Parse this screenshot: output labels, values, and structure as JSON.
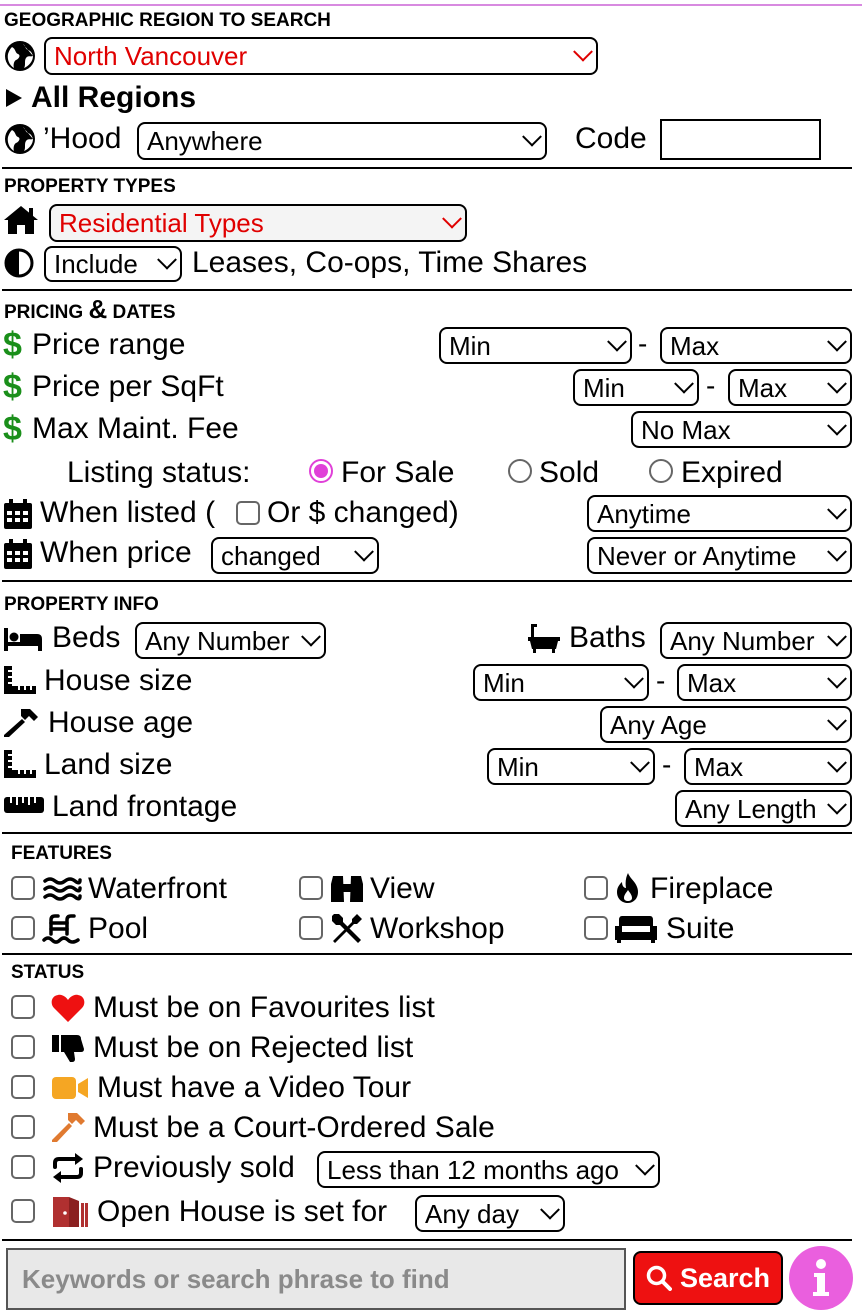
{
  "region": {
    "title": "GEOGRAPHIC REGION TO SEARCH",
    "region_select": "North Vancouver",
    "all_regions": "All Regions",
    "hood_label": "’Hood",
    "hood_select": "Anywhere",
    "code_label": "Code",
    "code_value": ""
  },
  "property_types": {
    "title": "PROPERTY TYPES",
    "types_select": "Residential Types",
    "include_select": "Include",
    "include_label": "Leases, Co-ops, Time Shares"
  },
  "pricing": {
    "title_a": "PRICING",
    "title_amp": "&",
    "title_b": "DATES",
    "price_range_label": "Price range",
    "price_min": "Min",
    "price_max": "Max",
    "sqft_label": "Price per SqFt",
    "sqft_min": "Min",
    "sqft_max": "Max",
    "maint_label": "Max Maint. Fee",
    "maint_select": "No Max",
    "status_label": "Listing status:",
    "status_options": [
      "For Sale",
      "Sold",
      "Expired"
    ],
    "status_selected": "For Sale",
    "listed_label_a": "When listed (",
    "listed_label_b": "Or $ changed)",
    "listed_select": "Anytime",
    "price_label": "When price",
    "price_changed_select": "changed",
    "price_when_select": "Never or Anytime",
    "dash": "-"
  },
  "property_info": {
    "title": "PROPERTY INFO",
    "beds_label": "Beds",
    "beds_select": "Any Number",
    "baths_label": "Baths",
    "baths_select": "Any Number",
    "house_size_label": "House size",
    "house_min": "Min",
    "house_max": "Max",
    "house_age_label": "House age",
    "house_age_select": "Any Age",
    "land_size_label": "Land size",
    "land_min": "Min",
    "land_max": "Max",
    "frontage_label": "Land frontage",
    "frontage_select": "Any Length"
  },
  "features": {
    "title": "FEATURES",
    "items": [
      "Waterfront",
      "View",
      "Fireplace",
      "Pool",
      "Workshop",
      "Suite"
    ]
  },
  "status": {
    "title": "STATUS",
    "favourites": "Must be on Favourites list",
    "rejected": "Must be on Rejected list",
    "video": "Must have a Video Tour",
    "court": "Must be a Court-Ordered Sale",
    "prev_sold": "Previously sold",
    "prev_sold_select": "Less than 12 months ago",
    "open_house": "Open House is set for",
    "open_house_select": "Any day"
  },
  "search": {
    "keywords_placeholder": "Keywords or search phrase to find",
    "search_label": "Search",
    "info_label": "i"
  },
  "colors": {
    "accent_red": "#e00000",
    "dollar_green": "#1a8f1a",
    "radio_pink": "#e040d8",
    "info_pink": "#ea5fde",
    "video_orange": "#f5a623",
    "gavel_orange": "#e07a30",
    "door_red": "#b03030"
  }
}
